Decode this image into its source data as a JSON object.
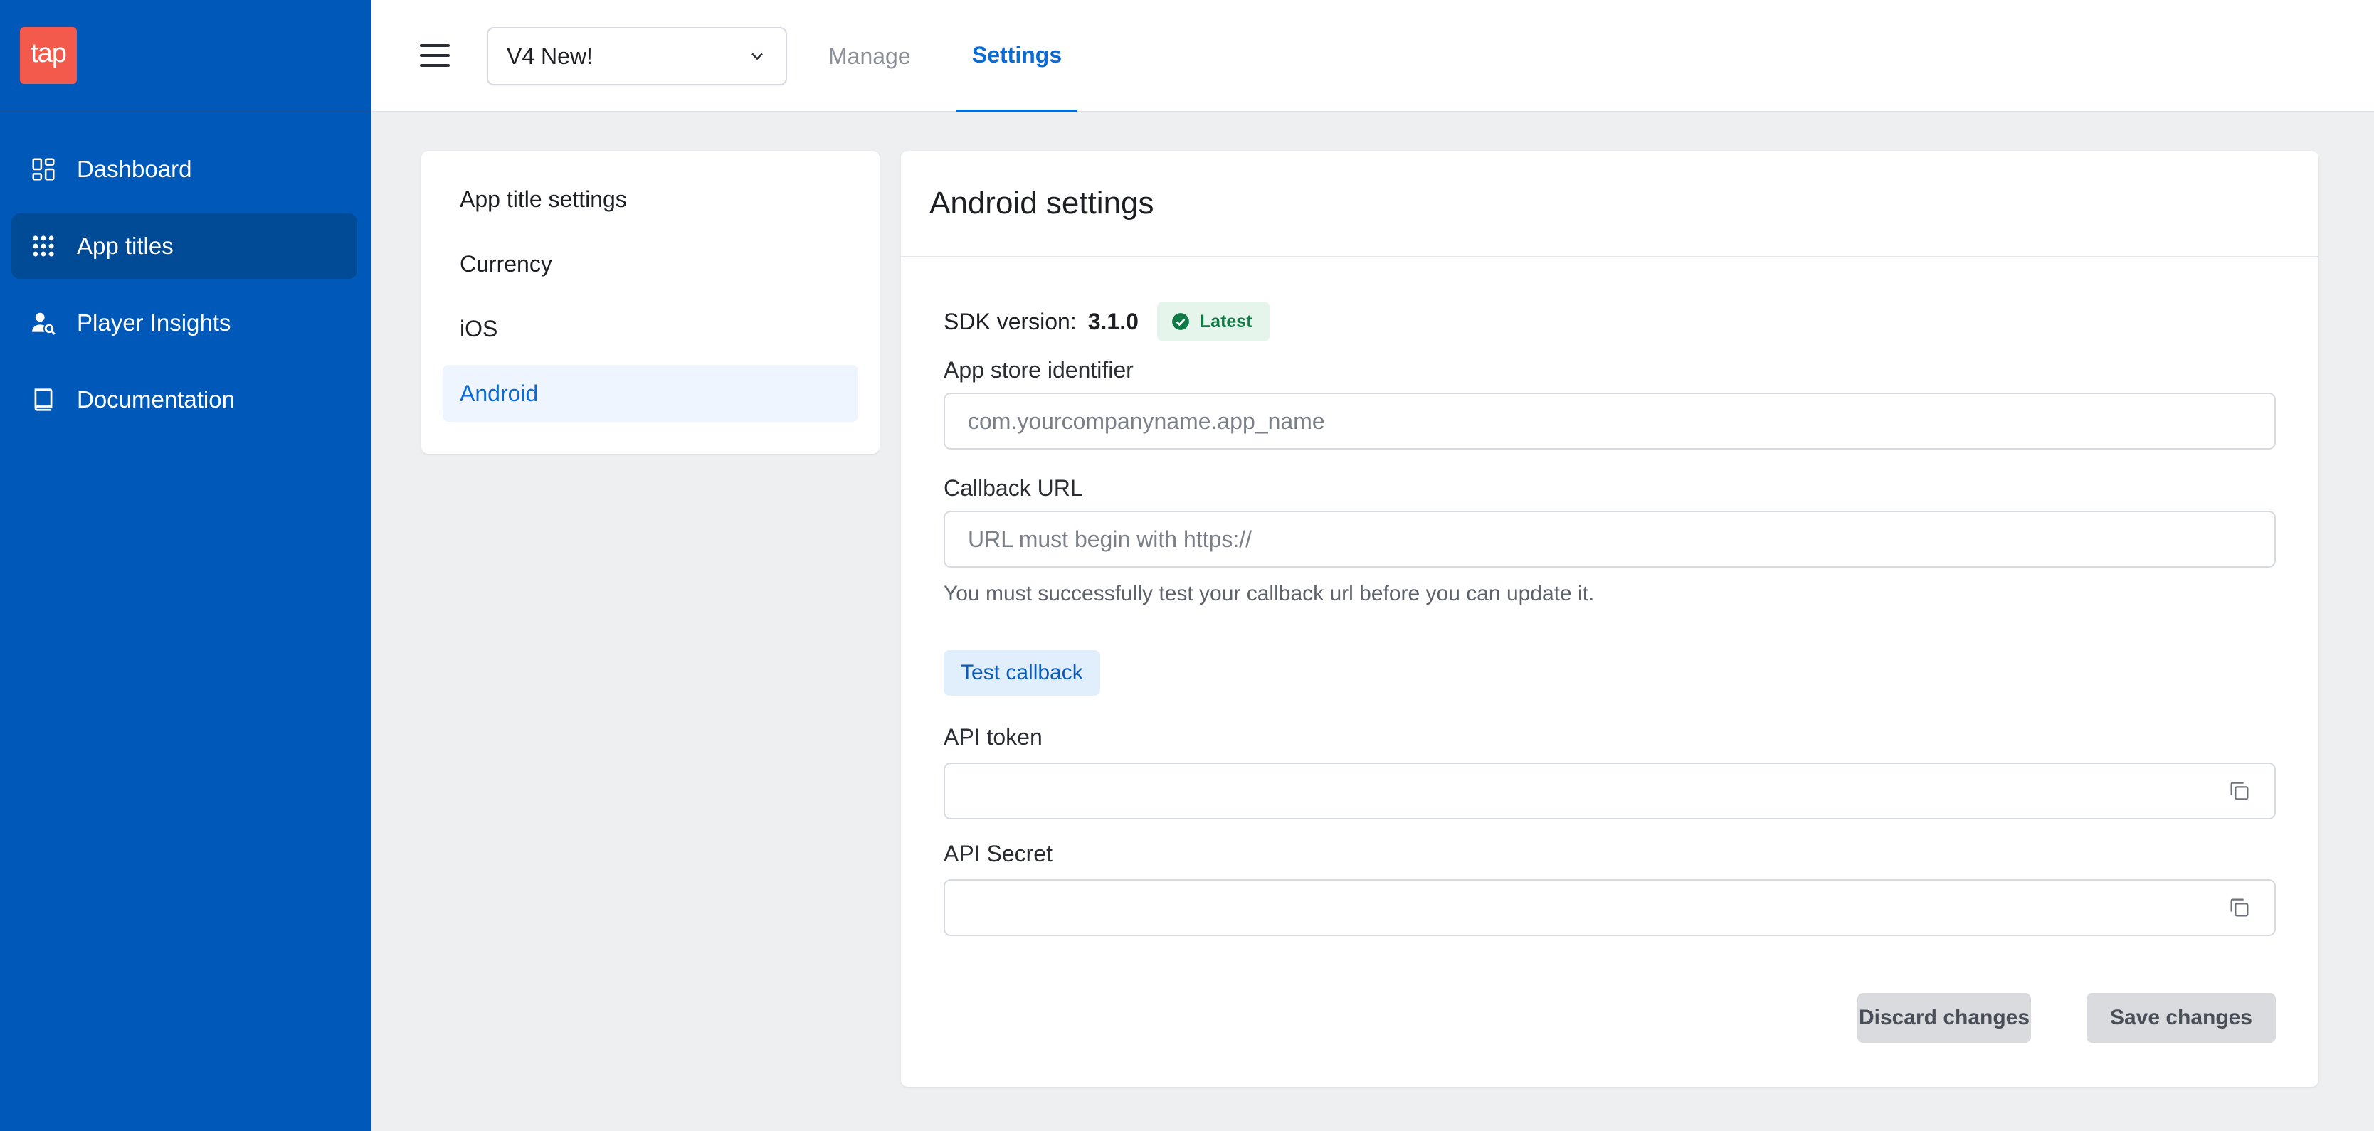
{
  "brand": {
    "logo_text": "tap",
    "logo_color": "#f45a4c",
    "sidebar_color": "#0059b8"
  },
  "sidebar": {
    "items": [
      {
        "label": "Dashboard",
        "icon": "dashboard-icon",
        "active": false
      },
      {
        "label": "App titles",
        "icon": "grid-dots-icon",
        "active": true
      },
      {
        "label": "Player Insights",
        "icon": "user-search-icon",
        "active": false
      },
      {
        "label": "Documentation",
        "icon": "book-icon",
        "active": false
      }
    ]
  },
  "topbar": {
    "app_selector_value": "V4 New!",
    "tabs": [
      {
        "label": "Manage",
        "active": false
      },
      {
        "label": "Settings",
        "active": true
      }
    ]
  },
  "settings_menu": {
    "items": [
      {
        "label": "App title settings",
        "active": false
      },
      {
        "label": "Currency",
        "active": false
      },
      {
        "label": "iOS",
        "active": false
      },
      {
        "label": "Android",
        "active": true
      }
    ]
  },
  "android": {
    "title": "Android settings",
    "sdk_label": "SDK version:",
    "sdk_version": "3.1.0",
    "sdk_badge": "Latest",
    "app_store_label": "App store identifier",
    "app_store_placeholder": "com.yourcompanyname.app_name",
    "callback_label": "Callback URL",
    "callback_placeholder": "URL must begin with https://",
    "callback_help": "You must successfully test your callback url before you can update it.",
    "test_callback_label": "Test callback",
    "api_token_label": "API token",
    "api_token_value": "",
    "api_secret_label": "API Secret",
    "api_secret_value": "",
    "discard_label": "Discard changes",
    "save_label": "Save changes"
  }
}
